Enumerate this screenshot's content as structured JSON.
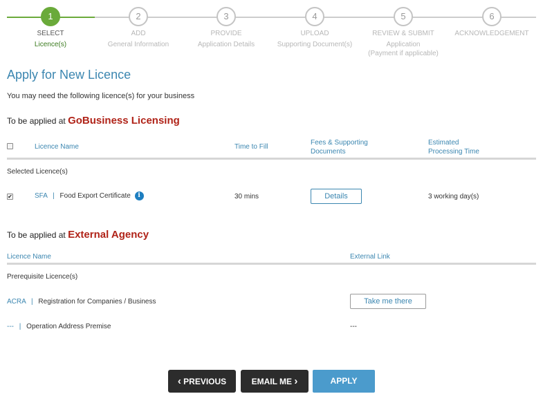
{
  "stepper": {
    "steps": [
      {
        "number": "1",
        "title": "SELECT",
        "subtitle": "Licence(s)",
        "subtitle2": "",
        "state": "active"
      },
      {
        "number": "2",
        "title": "ADD",
        "subtitle": "General Information",
        "subtitle2": "",
        "state": "pending"
      },
      {
        "number": "3",
        "title": "PROVIDE",
        "subtitle": "Application Details",
        "subtitle2": "",
        "state": "pending"
      },
      {
        "number": "4",
        "title": "UPLOAD",
        "subtitle": "Supporting Document(s)",
        "subtitle2": "",
        "state": "pending"
      },
      {
        "number": "5",
        "title": "REVIEW & SUBMIT",
        "subtitle": "Application",
        "subtitle2": "(Payment if applicable)",
        "state": "pending"
      },
      {
        "number": "6",
        "title": "ACKNOWLEDGEMENT",
        "subtitle": "",
        "subtitle2": "",
        "state": "pending"
      }
    ]
  },
  "page": {
    "title": "Apply for New Licence",
    "intro": "You may need the following licence(s) for your business"
  },
  "gobusiness": {
    "heading_prefix": "To be applied at",
    "heading_agency": "GoBusiness Licensing",
    "headers": {
      "licence_name": "Licence Name",
      "time_to_fill": "Time to Fill",
      "fees_line1": "Fees & Supporting",
      "fees_line2": "Documents",
      "est_line1": "Estimated",
      "est_line2": "Processing Time"
    },
    "group_label": "Selected Licence(s)",
    "rows": [
      {
        "agency": "SFA",
        "separator": "|",
        "name": "Food Export Certificate",
        "info_icon": "i",
        "time": "30 mins",
        "details_button": "Details",
        "processing": "3 working day(s)",
        "checked": true
      }
    ]
  },
  "external": {
    "heading_prefix": "To be applied at",
    "heading_agency": "External Agency",
    "headers": {
      "licence_name": "Licence Name",
      "external_link": "External Link"
    },
    "group_label": "Prerequisite Licence(s)",
    "rows": [
      {
        "agency": "ACRA",
        "separator": "|",
        "name": "Registration for Companies / Business",
        "link_button": "Take me there"
      },
      {
        "agency": "---",
        "separator": "|",
        "name": "Operation Address Premise",
        "link_text": "---"
      }
    ]
  },
  "footer": {
    "previous": "PREVIOUS",
    "email_me": "EMAIL ME",
    "apply": "APPLY",
    "chevron_left": "‹",
    "chevron_right": "›"
  },
  "colors": {
    "accent_blue": "#3b86b0",
    "agency_red": "#b02318",
    "step_active_green": "#6aaa3a",
    "apply_blue": "#4b9bcc",
    "dark_button": "#2c2c2c"
  }
}
